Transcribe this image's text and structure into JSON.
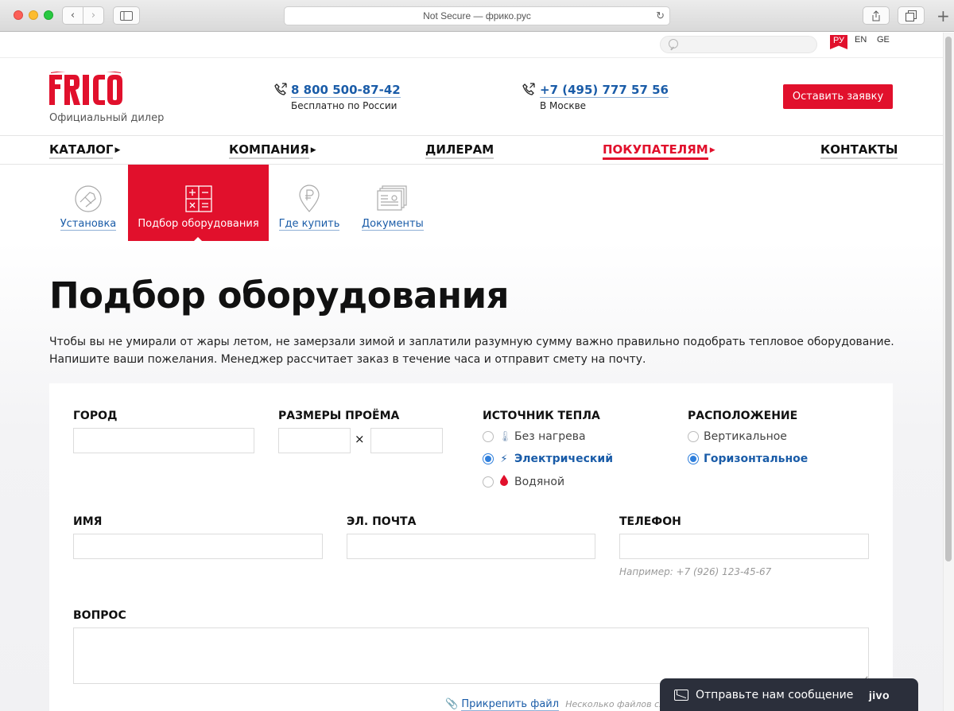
{
  "browser": {
    "url_text": "Not Secure — фрико.рус"
  },
  "topbar": {
    "search_placeholder": "",
    "langs": [
      "РУ",
      "EN",
      "GE"
    ]
  },
  "header": {
    "logo_text": "FRICO",
    "logo_subtitle": "Официальный дилер",
    "phone1": "8 800 500-87-42",
    "phone1_note": "Бесплатно по России",
    "phone2": "+7 (495) 777 57 56",
    "phone2_note": "В Москве",
    "cta": "Оставить заявку"
  },
  "main_nav": {
    "catalog": "КАТАЛОГ",
    "company": "КОМПАНИЯ",
    "dealers": "ДИЛЕРАМ",
    "buyers": "ПОКУПАТЕЛЯМ",
    "contacts": "КОНТАКТЫ"
  },
  "sub_nav": {
    "install": "Установка",
    "select": "Подбор оборудования",
    "where": "Где купить",
    "docs": "Документы"
  },
  "page": {
    "title": "Подбор оборудования",
    "intro": "Чтобы вы не умирали от жары летом, не замерзали зимой и заплатили разумную сумму важно правильно подобрать тепловое оборудование. Напишите ваши пожелания. Менеджер рассчитает заказ в течение часа и отправит смету на почту."
  },
  "form": {
    "city_label": "ГОРОД",
    "size_label": "РАЗМЕРЫ ПРОЁМА",
    "times": "×",
    "heat_label": "ИСТОЧНИК ТЕПЛА",
    "heat_options": [
      "Без нагрева",
      "Электрический",
      "Водяной"
    ],
    "heat_selected": "Электрический",
    "pos_label": "РАСПОЛОЖЕНИЕ",
    "pos_options": [
      "Вертикальное",
      "Горизонтальное"
    ],
    "pos_selected": "Горизонтальное",
    "name_label": "ИМЯ",
    "email_label": "ЭЛ. ПОЧТА",
    "phone_label": "ТЕЛЕФОН",
    "phone_hint": "Например: +7 (926) 123-45-67",
    "question_label": "ВОПРОС",
    "attach": "Прикрепить файл",
    "attach_note": "Несколько файлов сж"
  },
  "chat": {
    "text": "Отправьте нам сообщение",
    "brand": "jivo"
  },
  "colors": {
    "brand_red": "#e1102c",
    "link_blue": "#1a5ca8",
    "radio_blue": "#2f7fdc"
  }
}
